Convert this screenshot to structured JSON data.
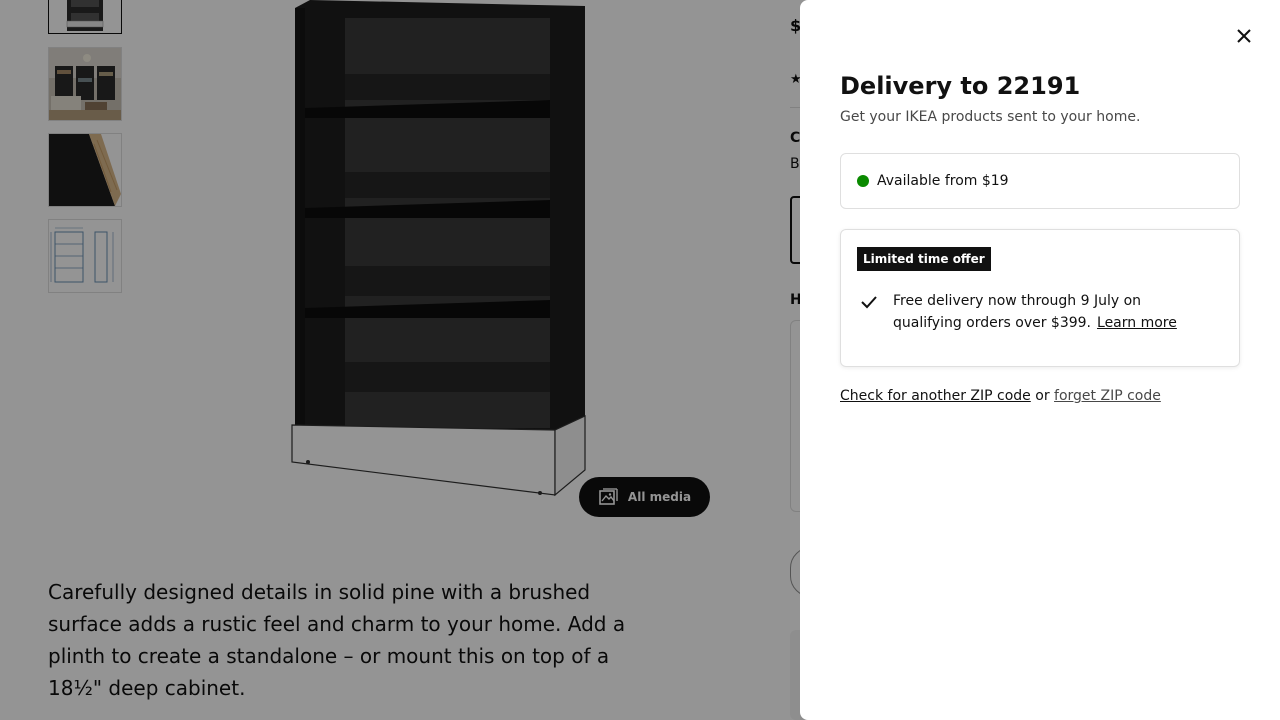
{
  "product_page": {
    "description": "Carefully designed details in solid pine with a brushed surface adds a rustic feel and charm to your home. Add a plinth to create a standalone – or mount this on top of a 18½\" deep cabinet.",
    "all_media_label": "All media",
    "right_column_fragments": {
      "price_fragment": "$",
      "section_c": "C",
      "section_b": "B",
      "section_h": "H"
    }
  },
  "delivery_modal": {
    "title": "Delivery to 22191",
    "subtitle": "Get your IKEA products sent to your home.",
    "availability": "Available from $19",
    "offer": {
      "badge": "Limited time offer",
      "text": "Free delivery now through 9 July on qualifying orders over $399.",
      "link": "Learn more"
    },
    "zip_actions": {
      "check_link": "Check for another ZIP code",
      "separator": "or",
      "forget_link": "forget ZIP code"
    }
  },
  "colors": {
    "status_green": "#0a8a00",
    "overlay": "rgba(0,0,0,0.42)",
    "badge_bg": "#111111"
  }
}
